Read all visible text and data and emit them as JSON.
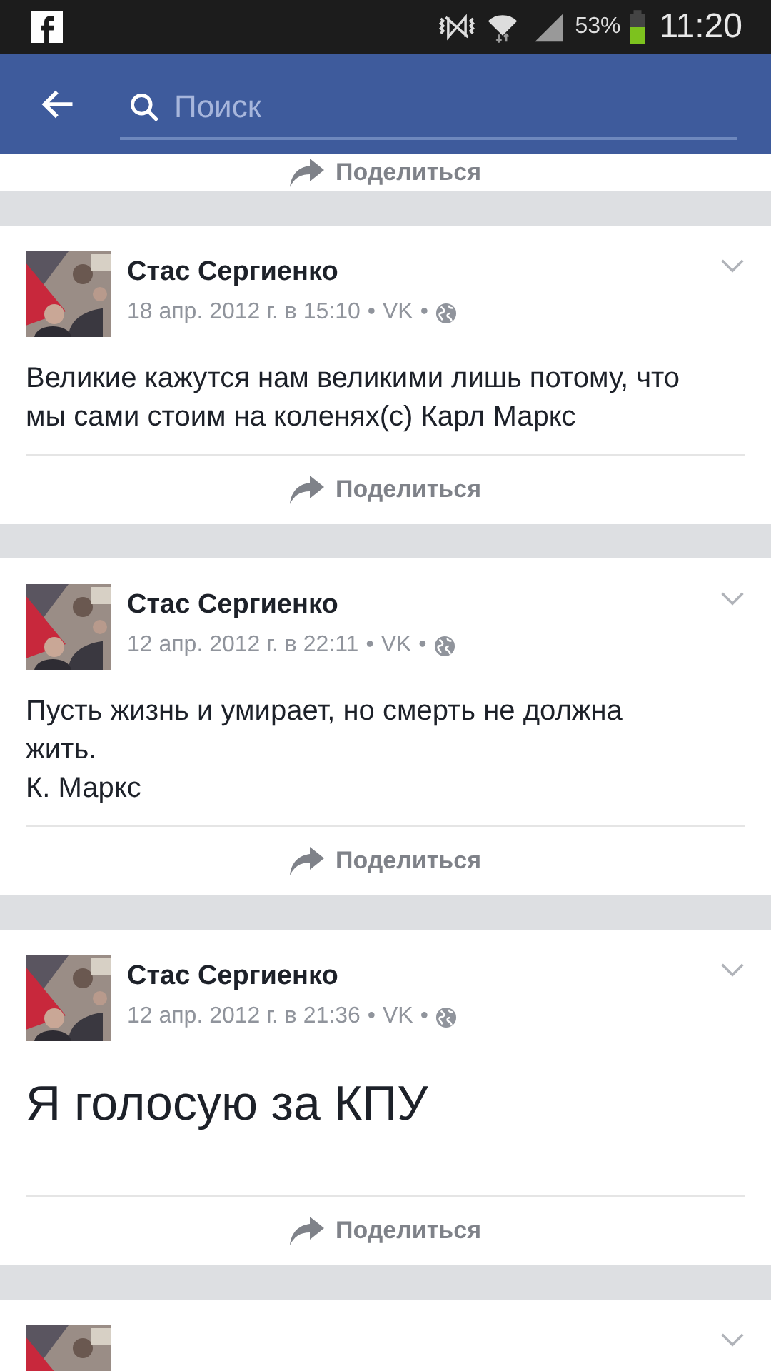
{
  "status_bar": {
    "battery": "53%",
    "time": "11:20"
  },
  "toolbar": {
    "search": {
      "placeholder": "Поиск"
    }
  },
  "top_share": {
    "label": "Поделиться"
  },
  "posts": [
    {
      "author": "Стас Сергиенко",
      "date": "18 апр. 2012 г. в 15:10",
      "source": "VK",
      "separator": "•",
      "body": "Великие кажутся нам великими лишь потому, что мы сами стоим на коленях(с) Карл Маркс",
      "kind": "normal",
      "share": "Поделиться"
    },
    {
      "author": "Стас Сергиенко",
      "date": "12 апр. 2012 г. в 22:11",
      "source": "VK",
      "separator": "•",
      "body": "Пусть жизнь и умирает, но смерть не должна жить.\nК. Маркс",
      "kind": "normal",
      "share": "Поделиться"
    },
    {
      "author": "Стас Сергиенко",
      "date": "12 апр. 2012 г. в 21:36",
      "source": "VK",
      "separator": "•",
      "body": "Я голосую за КПУ",
      "kind": "large",
      "share": "Поделиться"
    }
  ]
}
